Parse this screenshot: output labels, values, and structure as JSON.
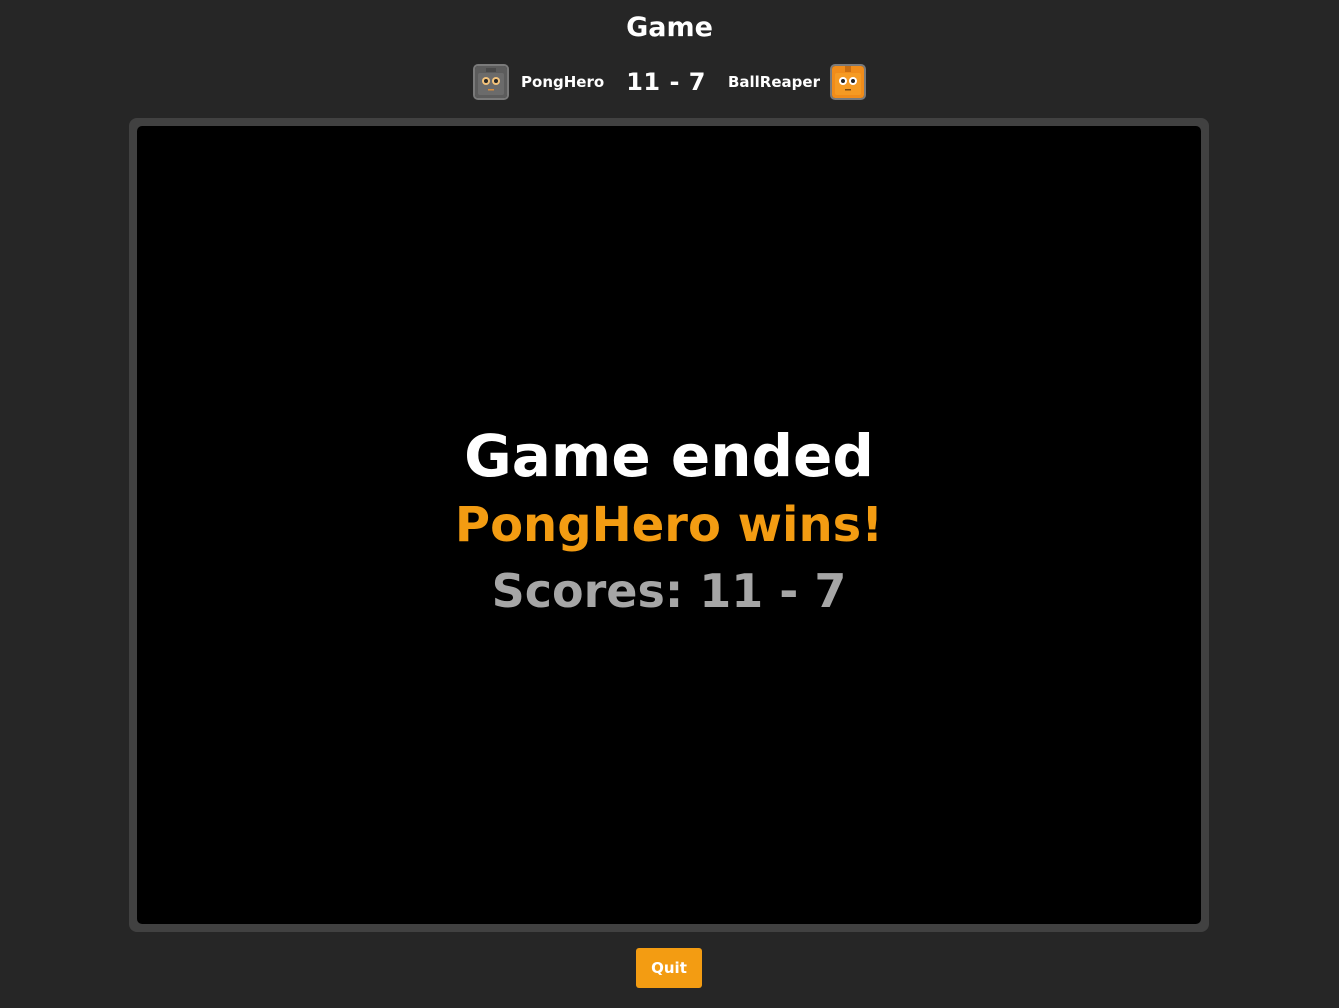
{
  "header": {
    "title": "Game"
  },
  "scoreboard": {
    "player_left": {
      "name": "PongHero",
      "avatar": "robot-avatar-gray"
    },
    "player_right": {
      "name": "BallReaper",
      "avatar": "robot-avatar-orange"
    },
    "score": "11 - 7"
  },
  "game": {
    "status_title": "Game ended",
    "winner_text": "PongHero wins!",
    "scores_text": "Scores: 11 - 7"
  },
  "actions": {
    "quit_label": "Quit"
  },
  "colors": {
    "background": "#262626",
    "frame": "#414141",
    "canvas": "#000000",
    "accent": "#f39c12",
    "muted_text": "#a6a6a6"
  }
}
